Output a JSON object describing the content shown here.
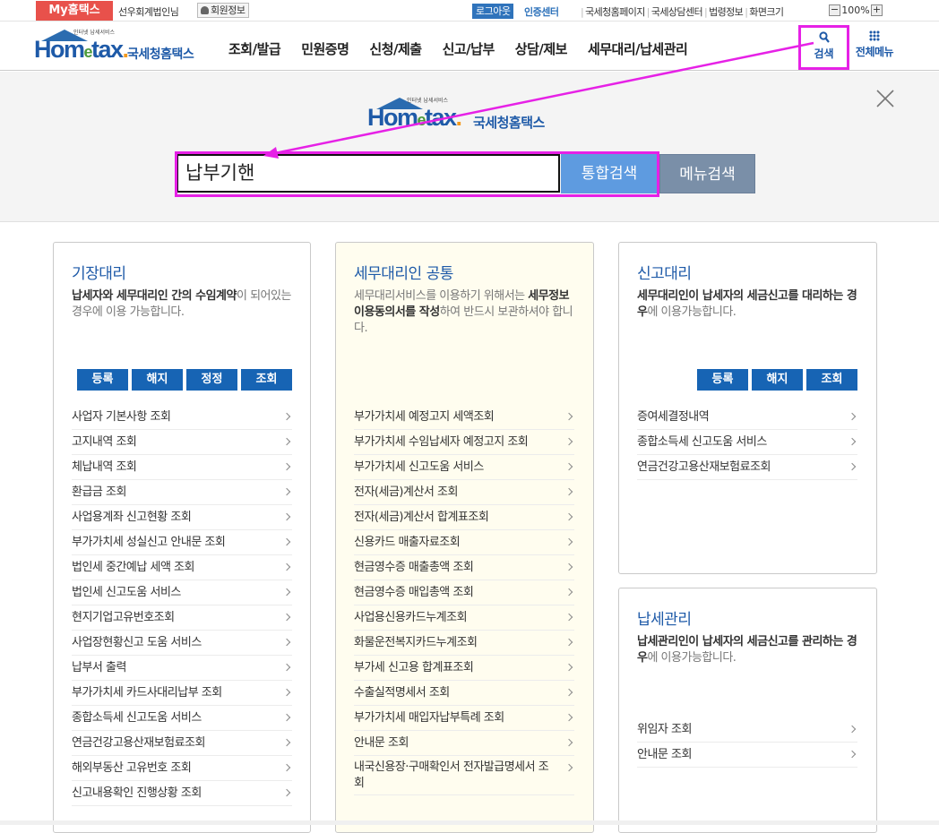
{
  "topbar": {
    "myhome": "My홈택스",
    "user": "선우회계법인님",
    "member_info": "회원정보",
    "logout": "로그아웃",
    "cert_center": "인증센터",
    "links": [
      "국세청홈페이지",
      "국세상담센터",
      "법령정보",
      "화면크기"
    ],
    "zoom_minus": "−",
    "zoom_value": "100%",
    "zoom_plus": "+"
  },
  "header": {
    "logo_small": "인터넷 납세서비스",
    "logo_word_a": "Hom",
    "logo_word_e": "e",
    "logo_word_b": "tax",
    "logo_dot": ".",
    "logo_kname": "국세청홈택스",
    "nav": [
      "조회/발급",
      "민원증명",
      "신청/제출",
      "신고/납부",
      "상담/제보",
      "세무대리/납세관리"
    ],
    "search_label": "검색",
    "allmenu_label": "전체메뉴"
  },
  "search": {
    "logo_small": "인터넷 납세서비스",
    "logo_kname": "국세청홈택스",
    "query": "납부기핸",
    "btn_integrated": "통합검색",
    "btn_menu": "메뉴검색"
  },
  "cards": {
    "bookkeeping": {
      "title": "기장대리",
      "desc_bold": "납세자와 세무대리인 간의 수임계약",
      "desc_rest": "이 되어있는 경우에 이용 가능합니다.",
      "buttons": [
        "등록",
        "해지",
        "정정",
        "조회"
      ],
      "items": [
        "사업자 기본사항 조회",
        "고지내역 조회",
        "체납내역 조회",
        "환급금 조회",
        "사업용계좌 신고현황 조회",
        "부가가치세 성실신고 안내문 조회",
        "법인세 중간예납 세액 조회",
        "법인세 신고도움 서비스",
        "현지기업고유번호조회",
        "사업장현황신고 도움 서비스",
        "납부서 출력",
        "부가가치세 카드사대리납부 조회",
        "종합소득세 신고도움 서비스",
        "연금건강고용산재보험료조회",
        "해외부동산 고유번호 조회",
        "신고내용확인 진행상황 조회"
      ]
    },
    "common": {
      "title": "세무대리인 공통",
      "desc_a": "세무대리서비스를 이용하기 위해서는 ",
      "desc_bold": "세무정보이용동의서를 작성",
      "desc_b": "하여 반드시 보관하셔야 합니다.",
      "items": [
        "부가가치세 예정고지 세액조회",
        "부가가치세 수임납세자 예정고지 조회",
        "부가가치세 신고도움 서비스",
        "전자(세금)계산서 조회",
        "전자(세금)계산서 합계표조회",
        "신용카드 매출자료조회",
        "현금영수증 매출총액 조회",
        "현금영수증 매입총액 조회",
        "사업용신용카드누계조회",
        "화물운전복지카드누계조회",
        "부가세 신고용 합계표조회",
        "수출실적명세서 조회",
        "부가가치세 매입자납부특례 조회",
        "안내문 조회",
        "내국신용장·구매확인서 전자발급명세서 조회"
      ]
    },
    "filing": {
      "title": "신고대리",
      "desc_bold": "세무대리인이 납세자의 세금신고를 대리하는 경우",
      "desc_rest": "에 이용가능합니다.",
      "buttons": [
        "등록",
        "해지",
        "조회"
      ],
      "items": [
        "증여세결정내역",
        "종합소득세 신고도움 서비스",
        "연금건강고용산재보험료조회"
      ]
    },
    "taxmgmt": {
      "title": "납세관리",
      "desc_bold": "납세관리인이 납세자의 세금신고를 관리하는 경우",
      "desc_rest": "에 이용가능합니다.",
      "items": [
        "위임자 조회",
        "안내문 조회"
      ]
    }
  },
  "colors": {
    "brand_blue": "#1e5aa8",
    "button_blue": "#1764b4",
    "highlight": "#e621e6",
    "myhome_red": "#e8514b"
  }
}
